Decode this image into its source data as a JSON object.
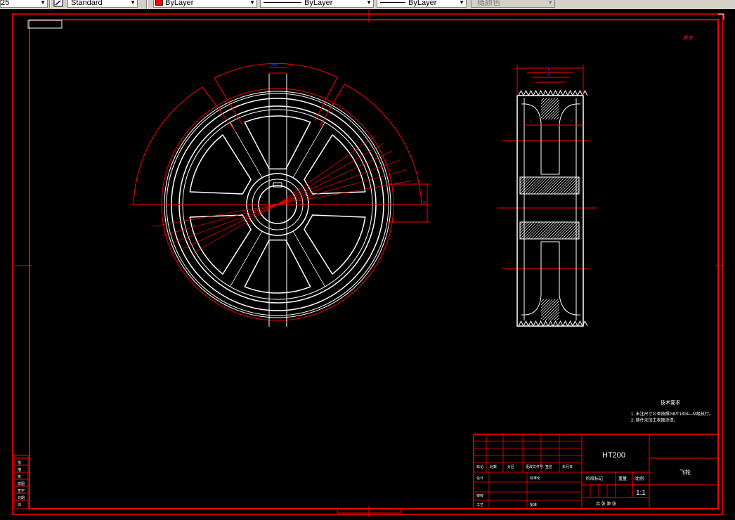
{
  "toolbar": {
    "layer_partial": "25",
    "text_style": "Standard",
    "color": "ByLayer",
    "linetype": "ByLayer",
    "lineweight": "ByLayer",
    "plot_style": "随颜色"
  },
  "drawing": {
    "top_right_note": "其余",
    "dimensions": {
      "keyway_width": "B±1",
      "center_hub": "Ø",
      "side_total": "L",
      "side_b1": "B",
      "side_b2": "b",
      "side_left": "e",
      "side_right": "e"
    },
    "tech_requirements": {
      "title": "技术要求",
      "line1": "1. 未注尺寸公差按照GB/T1804—M级执行。",
      "line2": "2. 铸件未加工表面涂漆。"
    },
    "title_block": {
      "material": "HT200",
      "part_name": "飞轮",
      "scale": "1:1",
      "headers": [
        "标记",
        "处数",
        "分区",
        "更改文件号",
        "签名",
        "年月日"
      ],
      "rows": [
        "设计",
        "标准化",
        "审核",
        "工艺",
        "批准"
      ],
      "stage_label": "阶段标记",
      "weight_label": "重量",
      "scale_label": "比例",
      "sheet_label": "共  张  第  张"
    },
    "left_margin_labels": [
      "借",
      "描",
      "校",
      "底图",
      "签字",
      "日期",
      "旧"
    ]
  }
}
